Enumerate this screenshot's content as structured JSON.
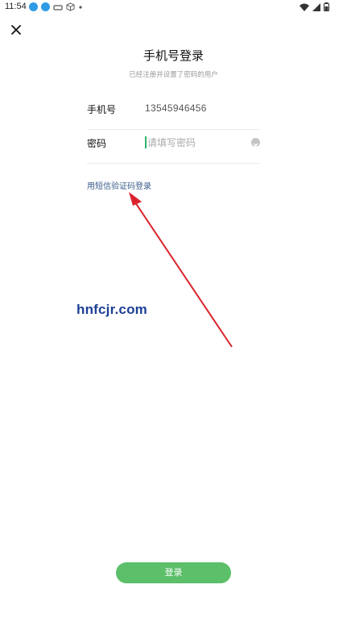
{
  "status_bar": {
    "time": "11:54",
    "left_icons": [
      "download-icon",
      "download-icon",
      "notification-icon",
      "cube-icon",
      "dot-icon"
    ],
    "right_icons": [
      "wifi-icon",
      "signal-icon",
      "battery-icon"
    ]
  },
  "header": {
    "title": "手机号登录",
    "subtitle": "已经注册并设置了密码的用户"
  },
  "form": {
    "phone_label": "手机号",
    "phone_value": "13545946456",
    "password_label": "密码",
    "password_placeholder": "请填写密码"
  },
  "links": {
    "sms_login": "用短信验证码登录"
  },
  "watermark": "hnfcjr.com",
  "actions": {
    "login_label": "登录"
  },
  "colors": {
    "accent_green": "#5cbf6a",
    "link_blue": "#3b5b8c",
    "arrow_red": "#d9232d"
  }
}
